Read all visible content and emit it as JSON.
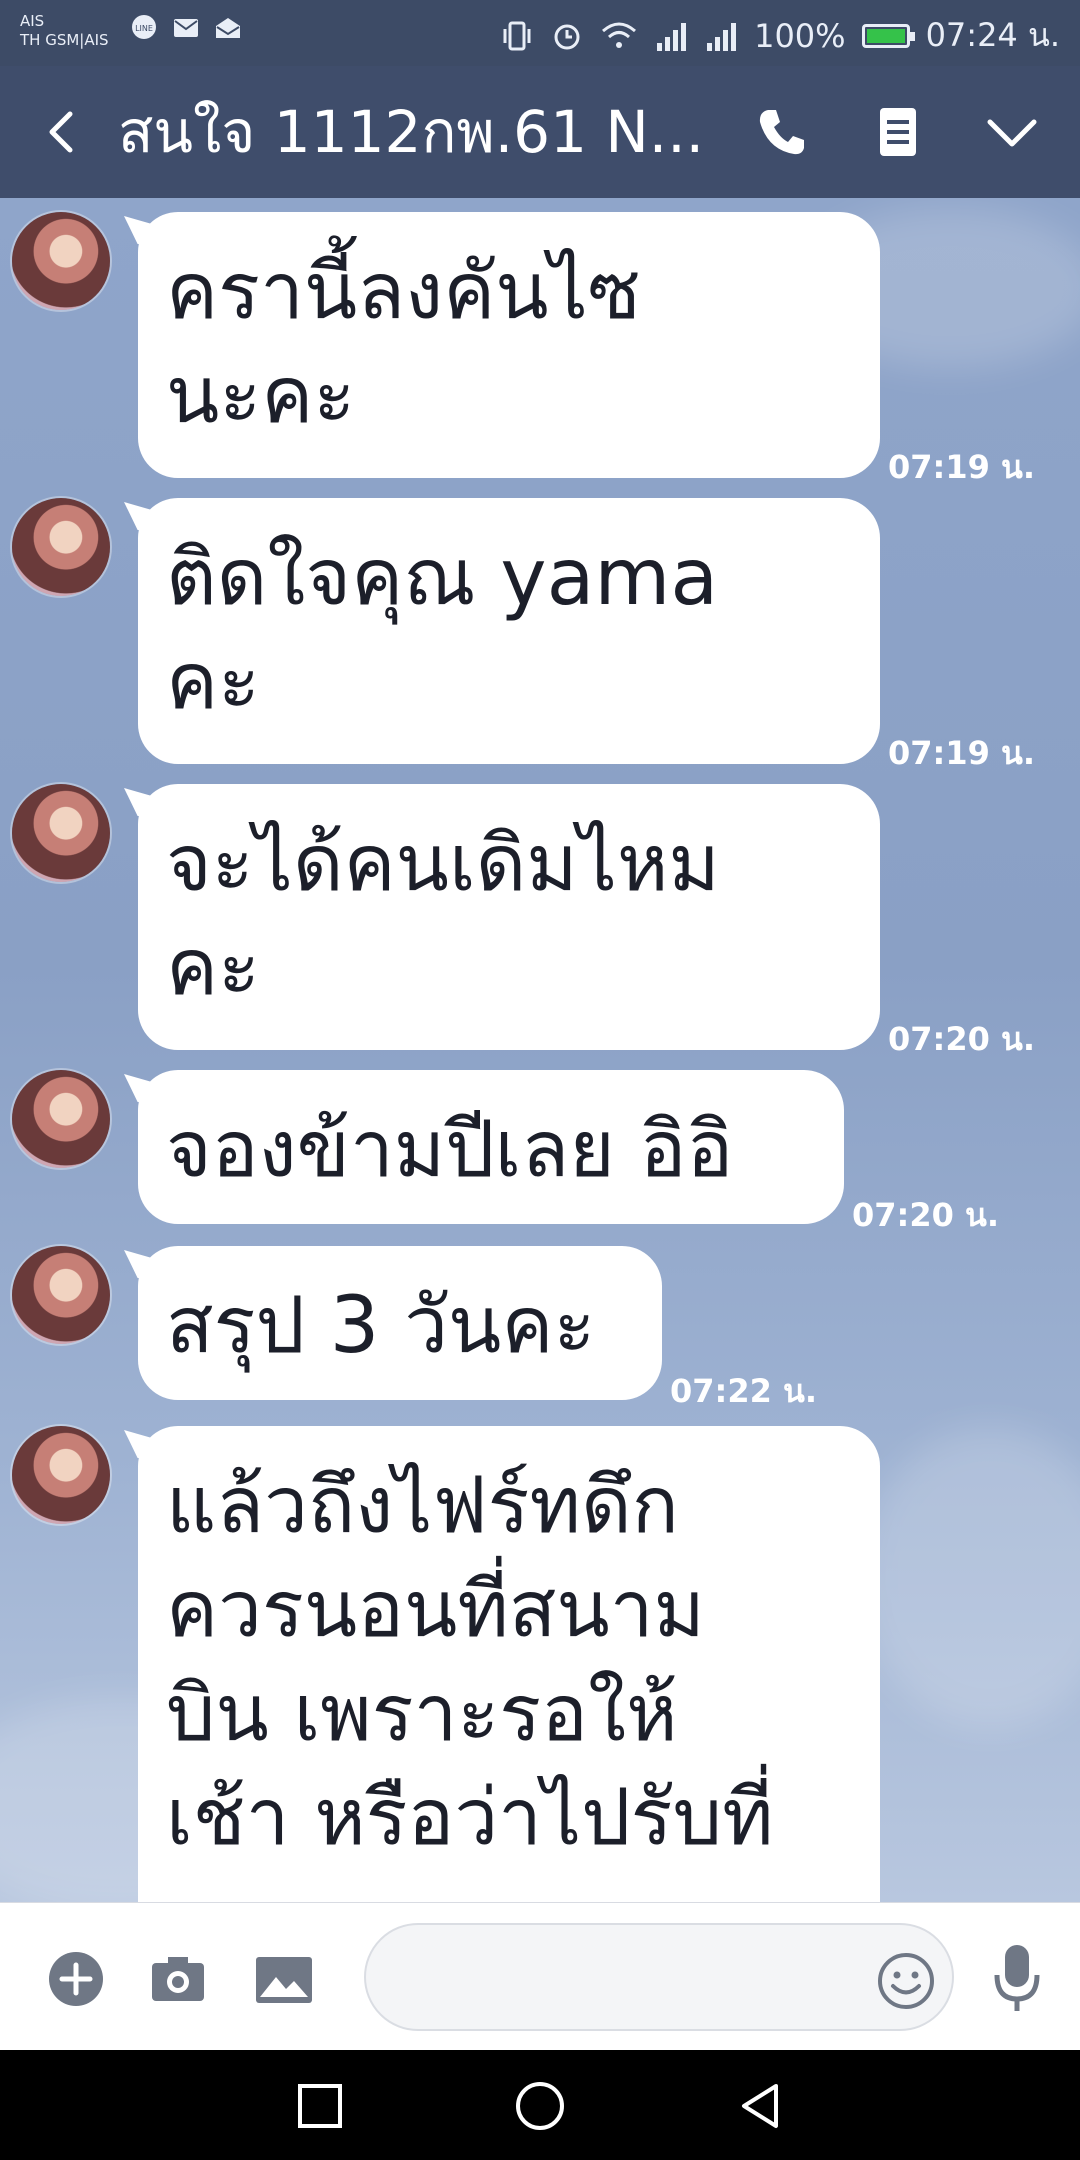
{
  "status_bar": {
    "carrier_line1": "AIS",
    "carrier_line2": "TH GSM|AIS",
    "battery_text": "100%",
    "battery_level": 1.0,
    "time": "07:24 น.",
    "icons": [
      "line-icon",
      "mail-icon",
      "mail-open-icon",
      "vibrate-icon",
      "alarm-icon",
      "wifi-icon",
      "signal-icon",
      "signal-icon-2",
      "battery-icon"
    ]
  },
  "header": {
    "title": "สนใจ 1112กพ.61 N...",
    "icons": [
      "back-icon",
      "phone-icon",
      "notes-icon",
      "chevron-down-icon"
    ]
  },
  "messages": [
    {
      "text": "ครานี้ลงคันไซ\nนะคะ",
      "time": "07:19 น."
    },
    {
      "text": "ติดใจคุณ yama\nคะ",
      "time": "07:19 น."
    },
    {
      "text": "จะได้คนเดิมไหม\nคะ",
      "time": "07:20 น."
    },
    {
      "text": "จองข้ามปีเลย อิอิ",
      "time": "07:20 น."
    },
    {
      "text": "สรุป 3 วันคะ",
      "time": "07:22 น."
    },
    {
      "text": "แล้วถึงไฟร์ทดึก\nควรนอนที่สนาม\nบิน เพราะรอให้\nเช้า หรือว่าไปรับที่",
      "time": ""
    }
  ],
  "input": {
    "placeholder": "",
    "icons": [
      "plus-icon",
      "camera-icon",
      "image-icon",
      "emoji-icon",
      "mic-icon"
    ]
  },
  "nav": {
    "icons": [
      "recent-apps-icon",
      "home-icon",
      "back-nav-icon"
    ]
  },
  "colors": {
    "status_bar": "#3d4b66",
    "header": "#3f4d6b",
    "chat_bg": "#8ea3c7",
    "bubble": "#ffffff",
    "battery_fill": "#35c24a"
  }
}
